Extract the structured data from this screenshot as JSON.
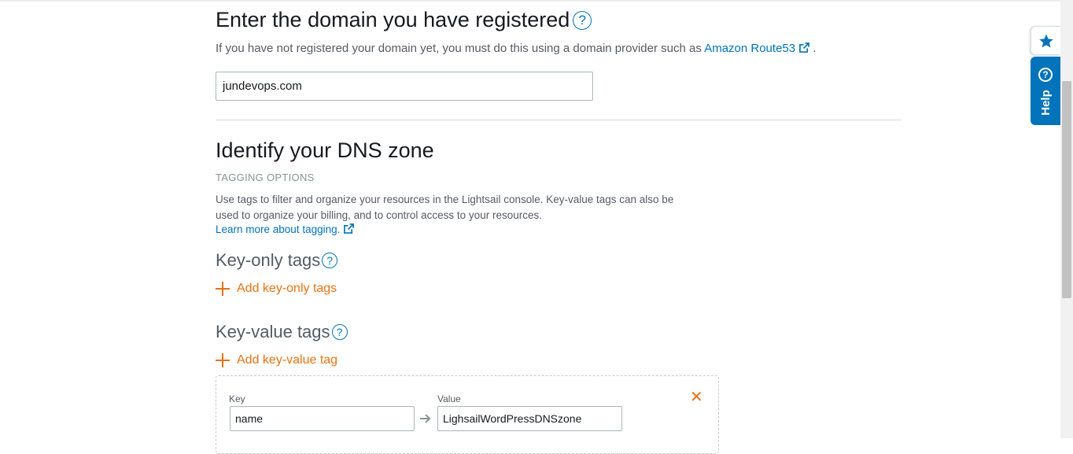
{
  "domain_section": {
    "title": "Enter the domain you have registered",
    "help_icon": "question-circle-icon",
    "description_prefix": "If you have not registered your domain yet, you must do this using a domain provider such as",
    "route53_link": "Amazon Route53",
    "description_suffix": ".",
    "domain_value": "jundevops.com"
  },
  "dns_section": {
    "title": "Identify your DNS zone",
    "tagging_label": "TAGGING OPTIONS",
    "tagging_description": "Use tags to filter and organize your resources in the Lightsail console. Key-value tags can also be used to organize your billing, and to control access to your resources.",
    "learn_more_link": "Learn more about tagging."
  },
  "key_only_tags": {
    "title": "Key-only tags",
    "add_label": "Add key-only tags"
  },
  "key_value_tags": {
    "title": "Key-value tags",
    "add_label": "Add key-value tag",
    "row": {
      "key_label": "Key",
      "key_value": "name",
      "value_label": "Value",
      "value_value": "LighsailWordPressDNSzone",
      "remove_icon": "close-icon"
    }
  },
  "side_tabs": {
    "favorite_icon": "star-icon",
    "help_label": "Help",
    "help_icon": "question-circle-icon"
  },
  "colors": {
    "link": "#0073bb",
    "accent_orange": "#ec7211",
    "help_tab": "#0073bb"
  }
}
